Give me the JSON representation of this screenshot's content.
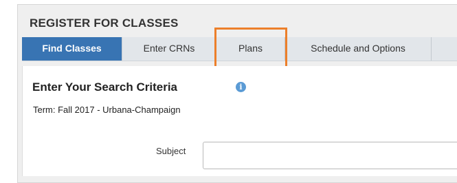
{
  "header": {
    "title": "REGISTER FOR CLASSES"
  },
  "tabs": [
    {
      "label": "Find Classes",
      "active": true
    },
    {
      "label": "Enter CRNs",
      "active": false
    },
    {
      "label": "Plans",
      "active": false
    },
    {
      "label": "Schedule and Options",
      "active": false
    }
  ],
  "search": {
    "heading": "Enter Your Search Criteria",
    "info_icon": "i",
    "term": "Term: Fall 2017 - Urbana-Champaign",
    "subject_label": "Subject",
    "subject_value": ""
  },
  "colors": {
    "active_tab": "#3874b3",
    "highlight": "#ec7f2a",
    "info_icon": "#5b9bd5"
  }
}
